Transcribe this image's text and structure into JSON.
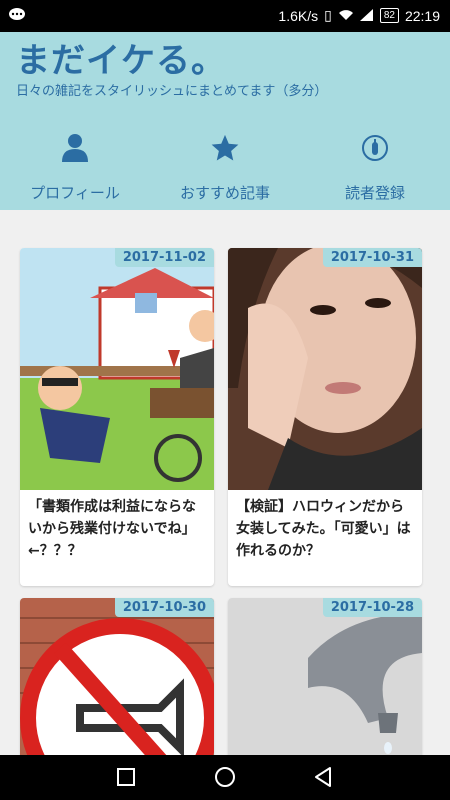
{
  "status": {
    "net_speed": "1.6K/s",
    "battery": "82",
    "time": "22:19"
  },
  "header": {
    "title": "まだイケる。",
    "subtitle": "日々の雑記をスタイリッシュにまとめてます（多分）"
  },
  "nav": [
    {
      "label": "プロフィール",
      "icon": "person-icon"
    },
    {
      "label": "おすすめ記事",
      "icon": "star-icon"
    },
    {
      "label": "読者登録",
      "icon": "subscribe-icon"
    }
  ],
  "articles": [
    {
      "date": "2017-11-02",
      "title": "「書類作成は利益にならないから残業付けないでね」←？？？"
    },
    {
      "date": "2017-10-31",
      "title": "【検証】ハロウィンだから女装してみた。「可愛い」は作れるのか？"
    },
    {
      "date": "2017-10-30",
      "title": ""
    },
    {
      "date": "2017-10-28",
      "title": ""
    }
  ],
  "colors": {
    "header_bg": "#a8dbe0",
    "accent": "#2b6da3"
  }
}
